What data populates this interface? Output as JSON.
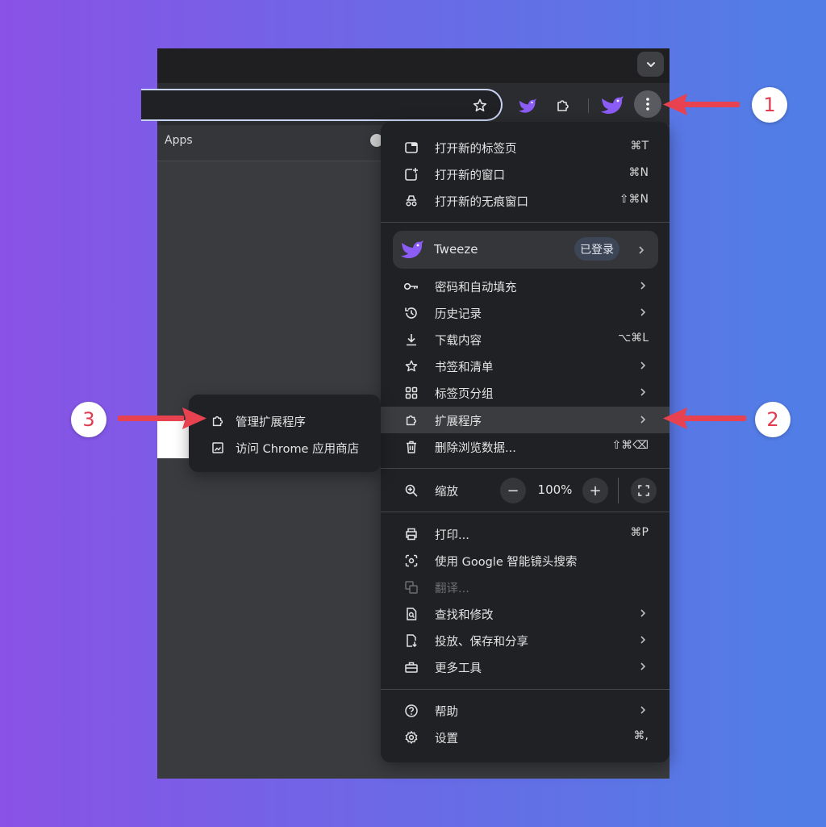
{
  "browser": {
    "bookmarks_bar": {
      "apps_label": "Apps"
    }
  },
  "menu": {
    "group1": [
      {
        "label": "打开新的标签页",
        "shortcut": "⌘T",
        "icon": "new-tab-icon"
      },
      {
        "label": "打开新的窗口",
        "shortcut": "⌘N",
        "icon": "new-window-icon"
      },
      {
        "label": "打开新的无痕窗口",
        "shortcut": "⇧⌘N",
        "icon": "incognito-icon"
      }
    ],
    "profile": {
      "name": "Tweeze",
      "badge": "已登录",
      "icon": "tweeze-bird-icon"
    },
    "group2": [
      {
        "label": "密码和自动填充",
        "icon": "key-icon"
      },
      {
        "label": "历史记录",
        "icon": "history-icon"
      },
      {
        "label": "下载内容",
        "shortcut": "⌥⌘L",
        "icon": "download-icon"
      },
      {
        "label": "书签和清单",
        "icon": "star-icon"
      },
      {
        "label": "标签页分组",
        "icon": "grid-icon"
      },
      {
        "label": "扩展程序",
        "icon": "puzzle-icon"
      },
      {
        "label": "删除浏览数据...",
        "shortcut": "⇧⌘⌫",
        "icon": "trash-icon"
      }
    ],
    "zoom": {
      "label": "缩放",
      "value": "100%",
      "minus": "−",
      "plus": "+"
    },
    "group3": [
      {
        "label": "打印...",
        "shortcut": "⌘P",
        "icon": "printer-icon"
      },
      {
        "label": "使用 Google 智能镜头搜索",
        "icon": "lens-icon"
      },
      {
        "label": "翻译...",
        "icon": "translate-icon"
      },
      {
        "label": "查找和修改",
        "icon": "find-icon"
      },
      {
        "label": "投放、保存和分享",
        "icon": "cast-save-icon"
      },
      {
        "label": "更多工具",
        "icon": "toolbox-icon"
      }
    ],
    "group4": [
      {
        "label": "帮助",
        "icon": "help-icon"
      },
      {
        "label": "设置",
        "shortcut": "⌘,",
        "icon": "settings-icon"
      }
    ]
  },
  "submenu": [
    {
      "label": "管理扩展程序",
      "icon": "puzzle-icon"
    },
    {
      "label": "访问 Chrome 应用商店",
      "icon": "store-icon"
    }
  ],
  "annotations": {
    "step1": "1",
    "step2": "2",
    "step3": "3"
  },
  "colors": {
    "arrow": "#e8414f",
    "accent_purple": "#8a52e6",
    "menu_bg": "#202124"
  }
}
